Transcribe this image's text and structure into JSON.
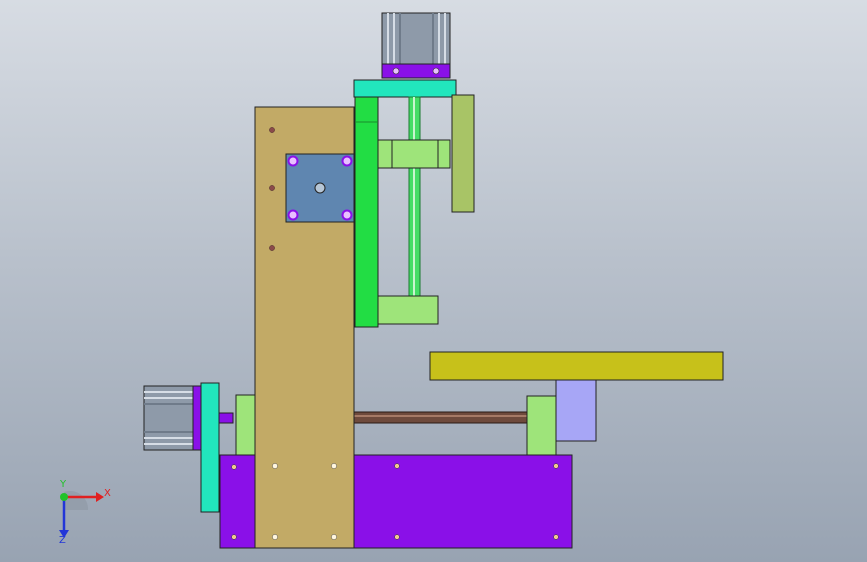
{
  "viewport": {
    "background_top": "#d7dce3",
    "background_bottom": "#98a3b2"
  },
  "colors": {
    "tan_plate": "#c2aa66",
    "purple_base": "#8a10e8",
    "bright_green": "#22dd44",
    "light_green": "#9ee47a",
    "olive": "#a8c466",
    "yellow_olive": "#c7c11a",
    "lavender": "#a7a6f6",
    "cyan": "#22e6bd",
    "motor_gray": "#8e9aa9",
    "motor_blue": "#5f86b0",
    "screw_brown": "#6e4a3c"
  },
  "triad": {
    "x_label": "X",
    "y_label": "Y",
    "z_label": "Z",
    "x_color": "#e02020",
    "y_color": "#22c22a",
    "z_color": "#2236d8"
  }
}
